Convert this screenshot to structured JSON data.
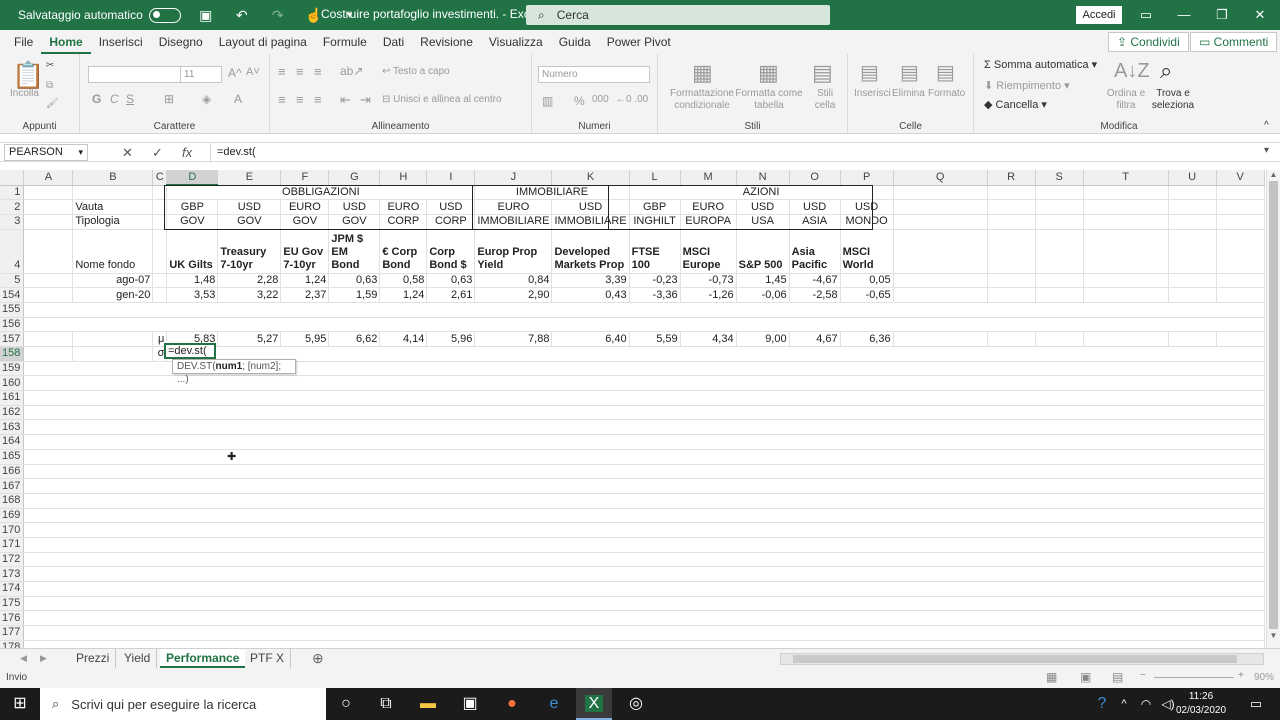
{
  "titlebar": {
    "autosave_label": "Salvataggio automatico",
    "doc_title": "Costruire portafoglio investimenti.  -  Excel",
    "search_placeholder": "Cerca",
    "signin": "Accedi"
  },
  "menu": {
    "items": [
      "File",
      "Home",
      "Inserisci",
      "Disegno",
      "Layout di pagina",
      "Formule",
      "Dati",
      "Revisione",
      "Visualizza",
      "Guida",
      "Power Pivot"
    ],
    "share": "Condividi",
    "comments": "Commenti"
  },
  "ribbon": {
    "appunti": {
      "label": "Appunti",
      "incolla": "Incolla"
    },
    "carattere": {
      "label": "Carattere",
      "size": "11",
      "bold": "G",
      "italic": "C",
      "underline": "S"
    },
    "allineamento": {
      "label": "Allineamento",
      "wrap": "Testo a capo",
      "merge": "Unisci e allinea al centro"
    },
    "numeri": {
      "label": "Numeri",
      "format": "Numero",
      "percent": "%",
      "thousands": "000"
    },
    "stili": {
      "label": "Stili",
      "cond": "Formattazione condizionale",
      "table": "Formatta come tabella",
      "cell": "Stili cella"
    },
    "celle": {
      "label": "Celle",
      "insert": "Inserisci",
      "delete": "Elimina",
      "format": "Formato"
    },
    "modifica": {
      "label": "Modifica",
      "autosum": "Somma automatica",
      "fill": "Riempimento",
      "clear": "Cancella",
      "sort": "Ordina e filtra",
      "find": "Trova e seleziona"
    }
  },
  "formulabar": {
    "namebox": "PEARSON",
    "formula": "=dev.st("
  },
  "columns": [
    "A",
    "B",
    "C",
    "D",
    "E",
    "F",
    "G",
    "H",
    "I",
    "J",
    "K",
    "L",
    "M",
    "N",
    "O",
    "P",
    "Q",
    "R",
    "S",
    "T",
    "U",
    "V"
  ],
  "rows": {
    "r1": {
      "num": "1",
      "obbligazioni": "OBBLIGAZIONI",
      "immobiliare": "IMMOBILIARE",
      "azioni": "AZIONI"
    },
    "r2": {
      "num": "2",
      "label": "Vauta",
      "cells": [
        "GBP",
        "USD",
        "EURO",
        "USD",
        "EURO",
        "USD",
        "EURO",
        "USD",
        "GBP",
        "EURO",
        "USD",
        "USD",
        "USD"
      ]
    },
    "r3": {
      "num": "3",
      "label": "Tipologia",
      "cells": [
        "GOV",
        "GOV",
        "GOV",
        "GOV",
        "CORP",
        "CORP",
        "IMMOBILIARE",
        "IMMOBILIARE",
        "INGHILT",
        "EUROPA",
        "USA",
        "ASIA",
        "MONDO"
      ]
    },
    "r4": {
      "num": "4",
      "label": "Nome fondo",
      "cells": [
        "UK Gilts",
        "Treasury 7-10yr",
        "EU Gov 7-10yr",
        "JPM $ EM Bond",
        "€ Corp Bond",
        "Corp Bond $",
        "Europ Prop Yield",
        "Developed Markets Prop",
        "FTSE 100",
        "MSCI Europe",
        "S&P 500",
        "Asia Pacific",
        "MSCI World"
      ]
    },
    "r5": {
      "num": "5",
      "label": "ago-07",
      "cells": [
        "1,48",
        "2,28",
        "1,24",
        "0,63",
        "0,58",
        "0,63",
        "0,84",
        "3,39",
        "-0,23",
        "-0,73",
        "1,45",
        "-4,67",
        "0,05"
      ]
    },
    "r154": {
      "num": "154",
      "label": "gen-20",
      "cells": [
        "3,53",
        "3,22",
        "2,37",
        "1,59",
        "1,24",
        "2,61",
        "2,90",
        "0,43",
        "-3,36",
        "-1,26",
        "-0,06",
        "-2,58",
        "-0,65"
      ]
    },
    "r155": {
      "num": "155"
    },
    "r156": {
      "num": "156"
    },
    "r157": {
      "num": "157",
      "symbol": "μ",
      "cells": [
        "5,83",
        "5,27",
        "5,95",
        "6,62",
        "4,14",
        "5,96",
        "7,88",
        "6,40",
        "5,59",
        "4,34",
        "9,00",
        "4,67",
        "6,36"
      ]
    },
    "r158": {
      "num": "158",
      "symbol": "σ"
    },
    "empty": [
      "159",
      "160",
      "161",
      "162",
      "163",
      "164",
      "165",
      "166",
      "167",
      "168",
      "169",
      "170",
      "171",
      "172",
      "173",
      "174",
      "175",
      "176",
      "177",
      "178"
    ]
  },
  "active_cell": {
    "text": "=dev.st("
  },
  "tooltip": {
    "fn": "DEV.ST(",
    "arg1": "num1",
    "rest": "; [num2]; ...)"
  },
  "sheets": [
    "Prezzi",
    "Yield",
    "Performance",
    "PTF X"
  ],
  "active_sheet": "Performance",
  "status": {
    "mode": "Invio",
    "zoom": "90%"
  },
  "taskbar": {
    "search": "Scrivi qui per eseguire la ricerca",
    "time": "11:26",
    "date": "02/03/2020"
  },
  "colors": {
    "excel_green": "#217346",
    "taskbar": "#1b1b1b"
  }
}
